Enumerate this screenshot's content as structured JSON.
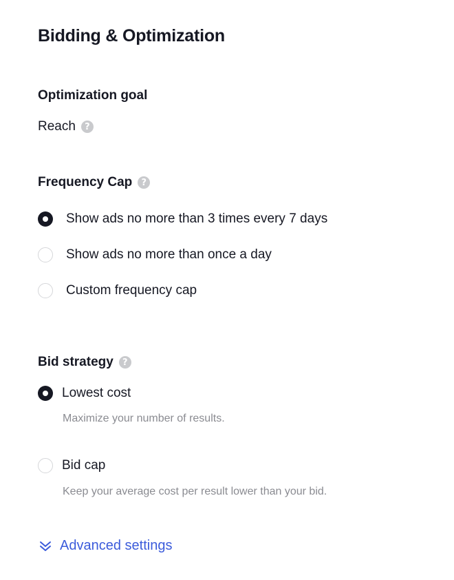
{
  "title": "Bidding & Optimization",
  "optimization": {
    "heading": "Optimization goal",
    "value": "Reach",
    "help_icon": "question-circle-icon"
  },
  "frequency_cap": {
    "heading": "Frequency Cap",
    "help_icon": "question-circle-icon",
    "selected_index": 0,
    "options": [
      {
        "label": "Show ads no more than 3 times every 7 days",
        "checked": true
      },
      {
        "label": "Show ads no more than once a day",
        "checked": false
      },
      {
        "label": "Custom frequency cap",
        "checked": false
      }
    ]
  },
  "bid_strategy": {
    "heading": "Bid strategy",
    "help_icon": "question-circle-icon",
    "options": [
      {
        "label": "Lowest cost",
        "description": "Maximize your number of results.",
        "checked": true
      },
      {
        "label": "Bid cap",
        "description": "Keep your average cost per result lower than your bid.",
        "checked": false
      }
    ]
  },
  "advanced": {
    "label": "Advanced settings",
    "icon": "double-chevron-down-icon",
    "color": "#3b5bdb"
  },
  "colors": {
    "text": "#161823",
    "muted": "#8a8b91",
    "help_icon": "#c9cacd",
    "radio_border": "#d5d6d9"
  }
}
